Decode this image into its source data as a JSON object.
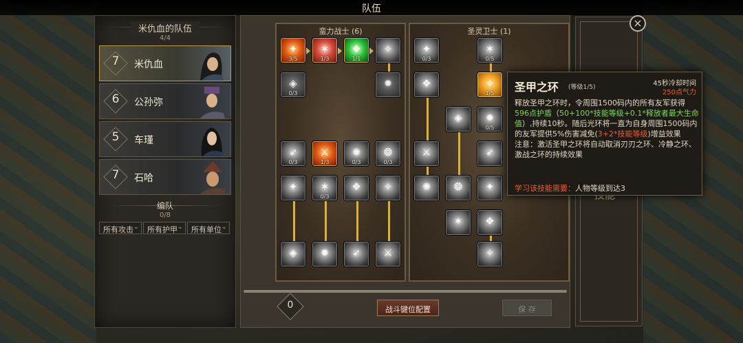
{
  "window": {
    "title": "队伍",
    "close_label": "×"
  },
  "team": {
    "header": "米仇血的队伍",
    "count": "4/4",
    "members": [
      {
        "level": "7",
        "name": "米仇血"
      },
      {
        "level": "6",
        "name": "公孙弥"
      },
      {
        "level": "5",
        "name": "车瑾"
      },
      {
        "level": "7",
        "name": "石哈"
      }
    ],
    "formation_label": "编队",
    "formation_count": "0/8",
    "filters": [
      "所有攻击",
      "所有护甲",
      "所有单位"
    ]
  },
  "skill_trees": [
    {
      "title": "蛮力战士 (6)",
      "nodes": [
        {
          "id": "b1",
          "style": "red",
          "count": "3/5"
        },
        {
          "id": "b2",
          "style": "pink",
          "count": "1/3"
        },
        {
          "id": "b3",
          "style": "green",
          "count": "1/1"
        },
        {
          "id": "b4",
          "style": "g",
          "count": ""
        },
        {
          "id": "b5",
          "style": "dark",
          "count": "0/3"
        },
        {
          "id": "b6",
          "style": "dark",
          "count": ""
        },
        {
          "id": "b7",
          "style": "g",
          "count": "0/3"
        },
        {
          "id": "b8",
          "style": "red",
          "count": "1/3"
        },
        {
          "id": "b9",
          "style": "g",
          "count": "0/3"
        },
        {
          "id": "b10",
          "style": "g",
          "count": "0/3"
        },
        {
          "id": "b11",
          "style": "g",
          "count": ""
        },
        {
          "id": "b12",
          "style": "g",
          "count": "0/3"
        },
        {
          "id": "b13",
          "style": "g",
          "count": ""
        },
        {
          "id": "b14",
          "style": "g",
          "count": ""
        },
        {
          "id": "b15",
          "style": "g",
          "count": ""
        },
        {
          "id": "b16",
          "style": "g",
          "count": ""
        },
        {
          "id": "b17",
          "style": "g",
          "count": ""
        },
        {
          "id": "b18",
          "style": "g",
          "count": ""
        }
      ]
    },
    {
      "title": "圣灵卫士 (1)",
      "nodes": [
        {
          "id": "s1",
          "style": "g",
          "count": "0/3"
        },
        {
          "id": "s2",
          "style": "g",
          "count": "0/5"
        },
        {
          "id": "s3",
          "style": "g",
          "count": ""
        },
        {
          "id": "s4",
          "style": "orange",
          "count": "1/5"
        },
        {
          "id": "s5",
          "style": "g",
          "count": ""
        },
        {
          "id": "s6",
          "style": "g",
          "count": "0/5"
        },
        {
          "id": "s7",
          "style": "g",
          "count": ""
        },
        {
          "id": "s8",
          "style": "g",
          "count": ""
        },
        {
          "id": "s9",
          "style": "g",
          "count": ""
        },
        {
          "id": "s10",
          "style": "g",
          "count": ""
        },
        {
          "id": "s11",
          "style": "g",
          "count": ""
        },
        {
          "id": "s12",
          "style": "g",
          "count": ""
        },
        {
          "id": "s13",
          "style": "g",
          "count": ""
        },
        {
          "id": "s14",
          "style": "g",
          "count": ""
        }
      ]
    }
  ],
  "footer": {
    "points": "0",
    "config_button": "战斗键位配置",
    "save_button": "保 存"
  },
  "side_tab": {
    "label": "技能"
  },
  "tooltip": {
    "title": "圣甲之环",
    "level": "(等级1/5)",
    "cooldown": "45秒冷却时间",
    "cost": "250点气力",
    "body_1": "释放圣甲之环时，令周围1500码内的所有友军获得",
    "body_green_1": "596点护盾",
    "body_2": "（",
    "body_green_2": "50+100*技能等级+0.1*释放者最大生命值",
    "body_3": "）,持续10秒。随后光环将一直为自身周围1500码内的友军提供5%伤害减免(",
    "body_red_1": "3+2*技能等级",
    "body_4": ")增益效果",
    "body_note": "注意：激活圣甲之环将自动取消刃刃之环、冷静之环、激战之环的持续效果",
    "req_label": "学习该技能需要：",
    "req_value": "人物等级到达3"
  },
  "colors": {
    "accent_gold": "#d6b04a",
    "tooltip_green": "#7fd65a",
    "tooltip_red": "#e0603a"
  }
}
